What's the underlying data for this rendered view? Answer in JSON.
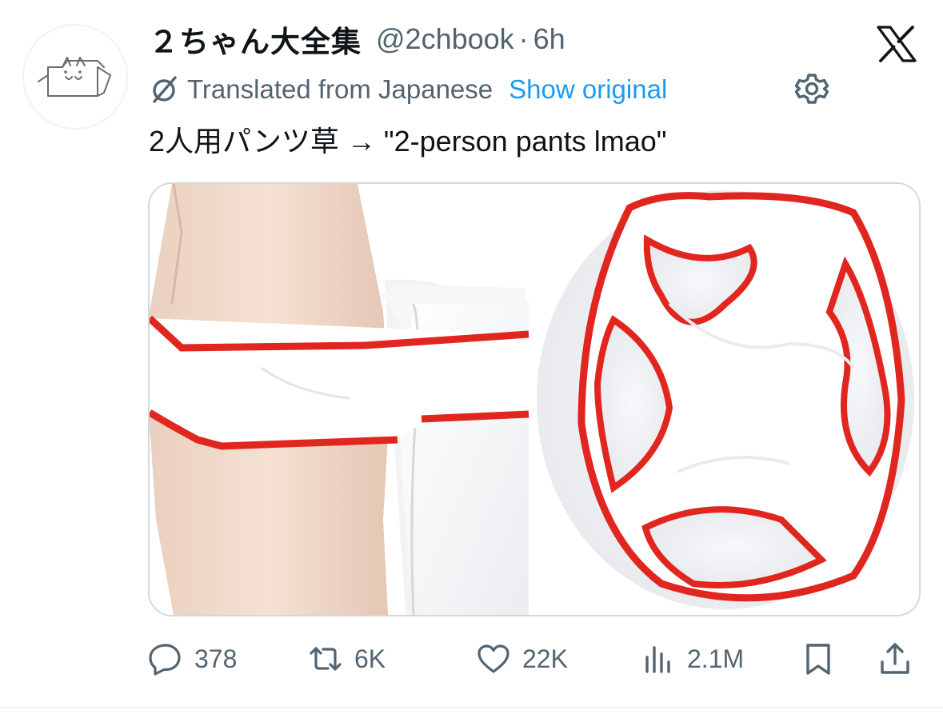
{
  "author": {
    "display_name": "２ちゃん大全集",
    "handle": "@2chbook",
    "separator": "·",
    "time": "6h"
  },
  "translation": {
    "label": "Translated from Japanese",
    "show_original": "Show original"
  },
  "tweet": {
    "text": "2人用パンツ草 → \"2-person pants lmao\""
  },
  "actions": {
    "replies": "378",
    "reposts": "6K",
    "likes": "22K",
    "views": "2.1M"
  },
  "colors": {
    "text": "#0f1419",
    "secondary": "#536471",
    "link": "#1d9bf0",
    "border": "#cfd9de",
    "trim_red": "#e0261f"
  },
  "icons": {
    "logo": "x-logo-icon",
    "translate": "translate-icon",
    "settings": "gear-icon",
    "reply": "reply-icon",
    "repost": "repost-icon",
    "like": "heart-icon",
    "views": "views-icon",
    "bookmark": "bookmark-icon",
    "share": "share-icon"
  }
}
